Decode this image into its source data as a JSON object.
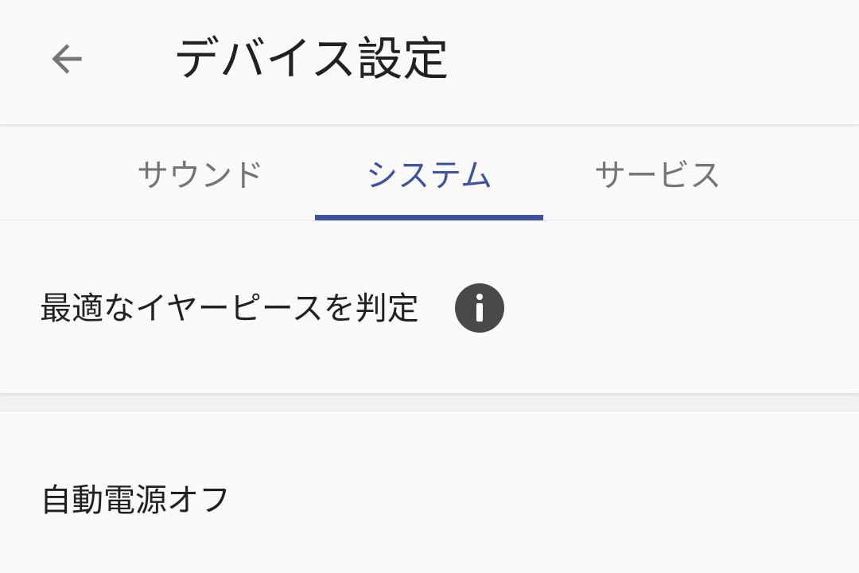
{
  "toolbar": {
    "title": "デバイス設定",
    "back_icon": "arrow-back-icon"
  },
  "tabs": [
    {
      "label": "サウンド",
      "active": false
    },
    {
      "label": "システム",
      "active": true
    },
    {
      "label": "サービス",
      "active": false
    }
  ],
  "colors": {
    "accent": "#3f51a1",
    "tab_inactive": "#757575",
    "text_primary": "#212121",
    "background": "#fafafa",
    "info_icon": "#494949"
  },
  "settings": [
    {
      "label": "最適なイヤーピースを判定",
      "icon": "info-icon"
    },
    {
      "label": "自動電源オフ"
    }
  ]
}
